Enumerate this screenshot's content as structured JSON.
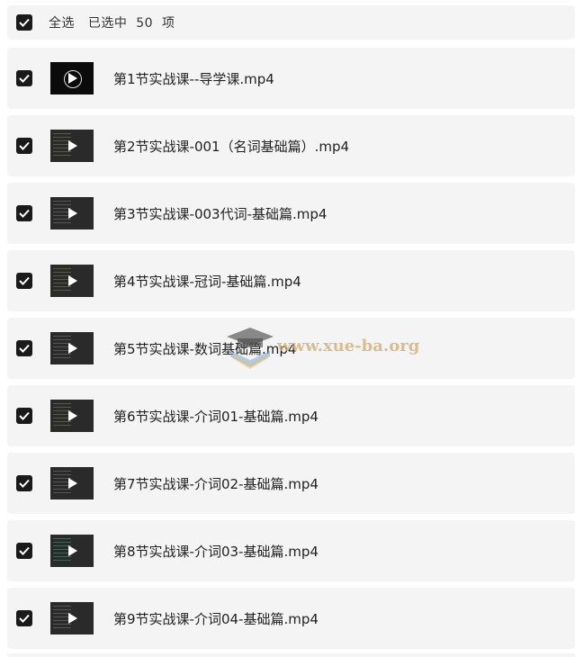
{
  "header": {
    "select_all": "全选",
    "selected_prefix": "已选中",
    "selected_count": "50",
    "selected_suffix": "项"
  },
  "files": [
    {
      "name": "第1节实战课--导学课.mp4",
      "checked": true
    },
    {
      "name": "第2节实战课-001（名词基础篇）.mp4",
      "checked": true
    },
    {
      "name": "第3节实战课-003代词-基础篇.mp4",
      "checked": true
    },
    {
      "name": "第4节实战课-冠词-基础篇.mp4",
      "checked": true
    },
    {
      "name": "第5节实战课-数词基础篇.mp4",
      "checked": true
    },
    {
      "name": "第6节实战课-介词01-基础篇.mp4",
      "checked": true
    },
    {
      "name": "第7节实战课-介词02-基础篇.mp4",
      "checked": true
    },
    {
      "name": "第8节实战课-介词03-基础篇.mp4",
      "checked": true
    },
    {
      "name": "第9节实战课-介词04-基础篇.mp4",
      "checked": true
    }
  ],
  "watermark": {
    "text": "www.xue-ba.org",
    "icon": "graduation-cap-book-icon"
  },
  "colors": {
    "row_background": "#f4f4f4",
    "checkbox": "#1a1a1a",
    "text": "#222222"
  }
}
